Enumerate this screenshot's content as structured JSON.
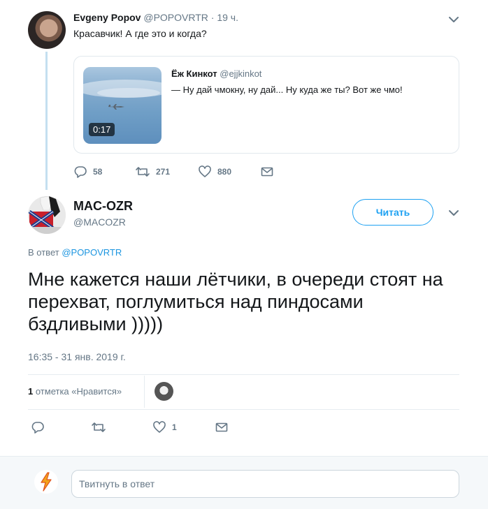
{
  "parent_tweet": {
    "name": "Evgeny Popov",
    "handle": "@POPOVRTR",
    "separator": "·",
    "time": "19 ч.",
    "text": "Красавчик! А где это и когда?",
    "quote": {
      "name": "Ёж Кинкот",
      "handle": "@ejjkinkot",
      "text": "— Ну дай чмокну, ну дай... Ну куда же ты? Вот же чмо!",
      "video_duration": "0:17"
    },
    "actions": {
      "replies": "58",
      "retweets": "271",
      "likes": "880"
    }
  },
  "main_tweet": {
    "name": "MAC-OZR",
    "handle": "@MACOZR",
    "follow_label": "Читать",
    "reply_to_prefix": "В ответ",
    "reply_to_mention": "@POPOVRTR",
    "text": "Мне кажется наши лётчики, в очереди стоят на перехват, поглумиться над пиндосами бздливыми )))))",
    "timestamp": "16:35 - 31 янв. 2019 г.",
    "likes_count": "1",
    "likes_label": "отметка «Нравится»",
    "actions": {
      "likes": "1"
    }
  },
  "reply_box": {
    "placeholder": "Твитнуть в ответ"
  },
  "colors": {
    "accent": "#1da1f2",
    "muted": "#657786",
    "thread_line": "#c4dff0"
  },
  "icons": [
    "chevron-down-icon",
    "reply-icon",
    "retweet-icon",
    "heart-icon",
    "message-icon",
    "play-video"
  ]
}
